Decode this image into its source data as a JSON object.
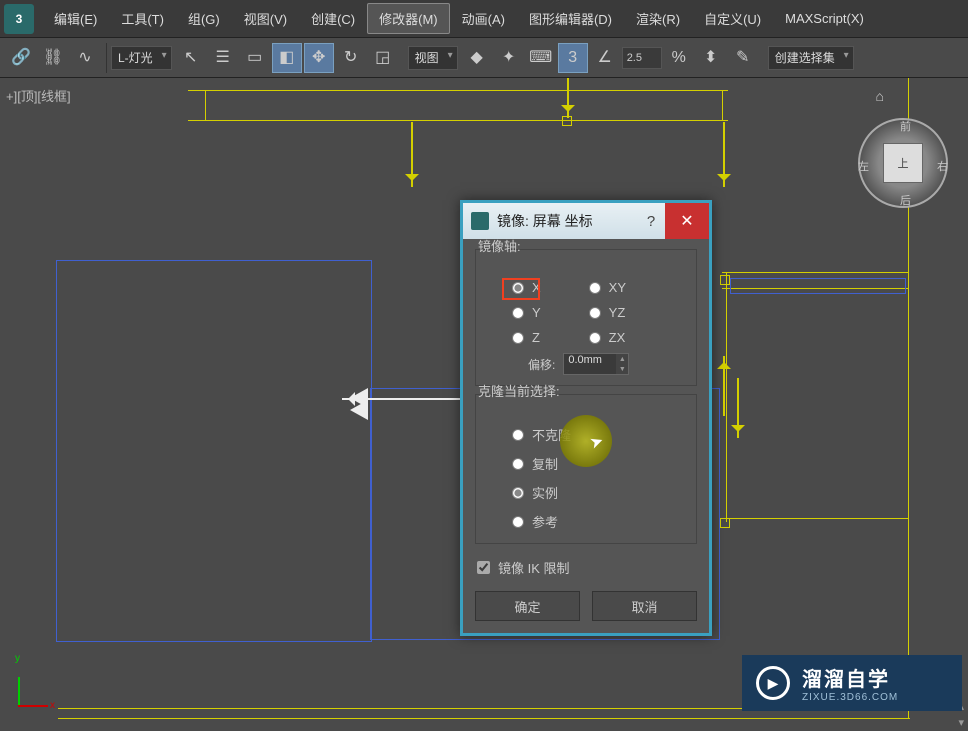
{
  "menu": {
    "items": [
      "编辑(E)",
      "工具(T)",
      "组(G)",
      "视图(V)",
      "创建(C)",
      "修改器(M)",
      "动画(A)",
      "图形编辑器(D)",
      "渲染(R)",
      "自定义(U)",
      "MAXScript(X)"
    ],
    "selected_index": 5
  },
  "toolbar": {
    "light_dropdown": "L-灯光",
    "view_dropdown": "视图",
    "angle_value": "2.5",
    "selection_set": "创建选择集"
  },
  "viewport": {
    "labels": "+][顶][线框]",
    "axis_x": "x",
    "axis_y": "y",
    "viewcube_face": "上",
    "viewcube_n": "前",
    "viewcube_s": "后",
    "viewcube_w": "左",
    "viewcube_e": "右"
  },
  "dialog": {
    "title": "镜像: 屏幕 坐标",
    "help": "?",
    "close": "✕",
    "axis_group": "镜像轴:",
    "axis_x": "X",
    "axis_y": "Y",
    "axis_z": "Z",
    "axis_xy": "XY",
    "axis_yz": "YZ",
    "axis_zx": "ZX",
    "offset_label": "偏移:",
    "offset_value": "0.0mm",
    "clone_group": "克隆当前选择:",
    "clone_none": "不克隆",
    "clone_copy": "复制",
    "clone_instance": "实例",
    "clone_reference": "参考",
    "ik_label": "镜像 IK 限制",
    "ok": "确定",
    "cancel": "取消"
  },
  "watermark": {
    "big": "溜溜自学",
    "small": "ZIXUE.3D66.COM"
  }
}
